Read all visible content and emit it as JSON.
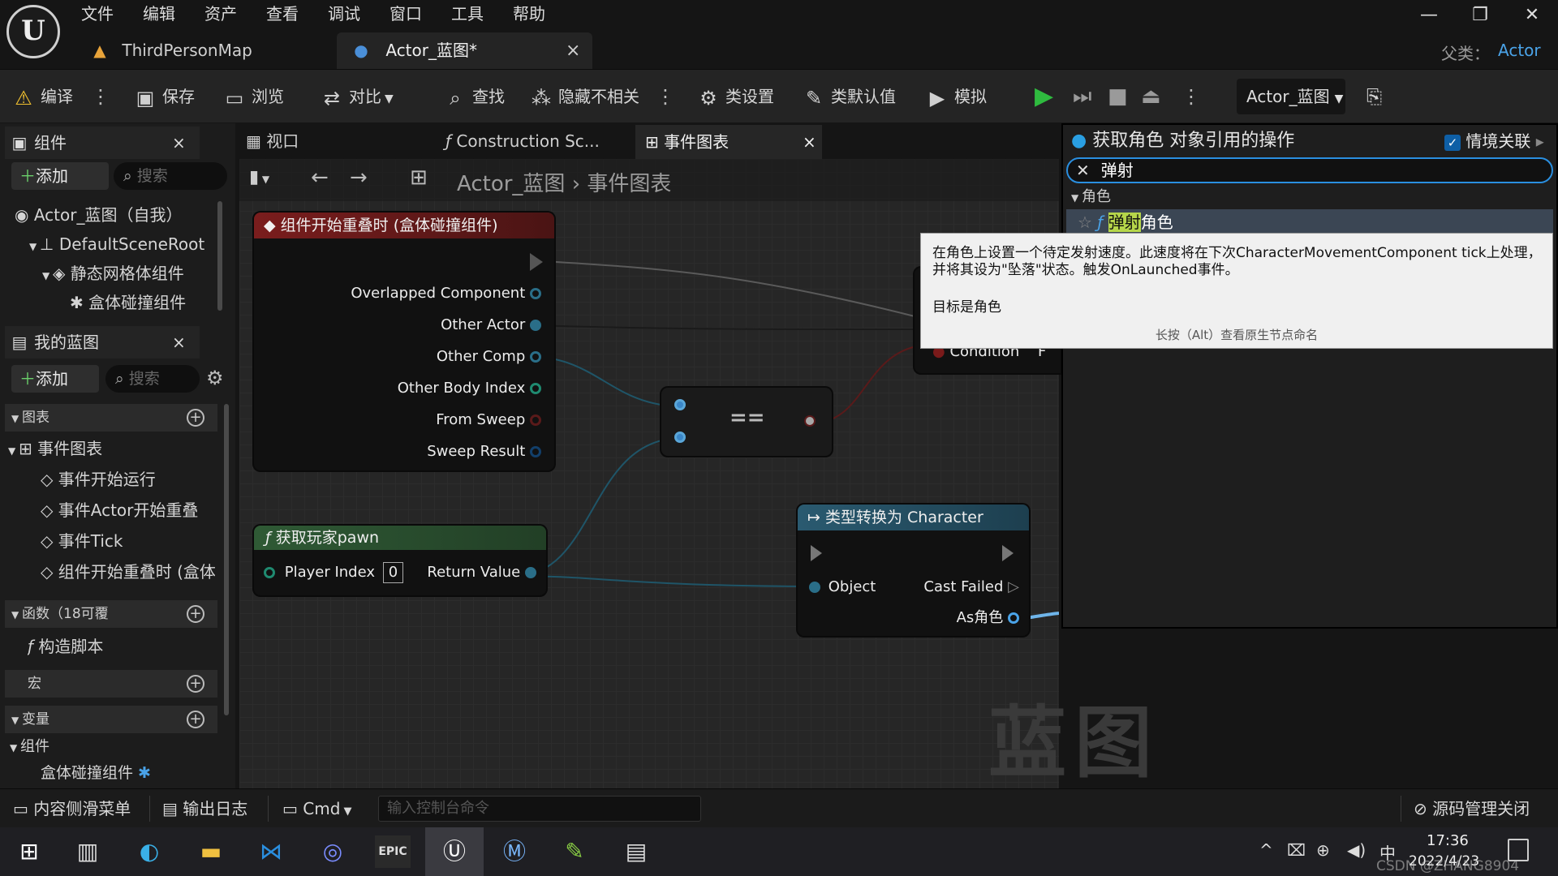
{
  "app": {
    "logo_text": "U",
    "parent_label": "父类：",
    "parent_value": "Actor"
  },
  "menu": [
    "文件",
    "编辑",
    "资产",
    "查看",
    "调试",
    "窗口",
    "工具",
    "帮助"
  ],
  "tabs": [
    {
      "label": "ThirdPersonMap"
    },
    {
      "label": "Actor_蓝图*",
      "close": "×"
    }
  ],
  "window": {
    "minimize": "—",
    "restore": "❐",
    "close": "✕"
  },
  "toolbar": {
    "compile": "编译",
    "save": "保存",
    "browse": "浏览",
    "diff": "对比",
    "find": "查找",
    "hide_unrelated": "隐藏不相关",
    "class_settings": "类设置",
    "class_defaults": "类默认值",
    "simulate": "模拟",
    "debug_object": "Actor_蓝图"
  },
  "components_panel": {
    "title": "组件",
    "add": "添加",
    "search_placeholder": "搜索",
    "items": [
      "Actor_蓝图（自我）",
      "DefaultSceneRoot",
      "静态网格体组件",
      "盒体碰撞组件"
    ]
  },
  "my_blueprint": {
    "title": "我的蓝图",
    "add": "添加",
    "search_placeholder": "搜索",
    "graphs_section": "图表",
    "event_graph": "事件图表",
    "events": [
      "事件开始运行",
      "事件Actor开始重叠",
      "事件Tick",
      "组件开始重叠时 (盒体"
    ],
    "functions_section": "函数（18可覆",
    "construction_script": "构造脚本",
    "macros_section": "宏",
    "variables_section": "变量",
    "components_category": "组件",
    "component_var": "盒体碰撞组件"
  },
  "graph_tabs": [
    {
      "label": "视口"
    },
    {
      "label": "Construction Sc..."
    },
    {
      "label": "事件图表",
      "close": "×"
    }
  ],
  "breadcrumb": {
    "root": "Actor_蓝图",
    "separator": "›",
    "current": "事件图表"
  },
  "nodes": {
    "overlap_event": {
      "title": "组件开始重叠时 (盒体碰撞组件)",
      "pins": [
        "Overlapped Component",
        "Other Actor",
        "Other Comp",
        "Other Body Index",
        "From Sweep",
        "Sweep Result"
      ]
    },
    "equal": {
      "label": "=="
    },
    "get_pawn": {
      "title": "获取玩家pawn",
      "input_label": "Player Index",
      "input_value": "0",
      "output_label": "Return Value"
    },
    "cast": {
      "title": "类型转换为 Character",
      "object_label": "Object",
      "cast_failed": "Cast Failed",
      "as_label": "As角色"
    },
    "branch": {
      "condition_label": "Condition",
      "false_label": "F"
    }
  },
  "watermark": "蓝图",
  "action_menu": {
    "title": "获取角色 对象引用的操作",
    "context_label": "情境关联",
    "search_value": "弹射",
    "category": "角色",
    "result_highlight": "弹射",
    "result_rest": "角色"
  },
  "tooltip": {
    "line1": "在角色上设置一个待定发射速度。此速度将在下次CharacterMovementComponent tick上处理，",
    "line2": "并将其设为\"坠落\"状态。触发OnLaunched事件。",
    "target": "目标是角色",
    "hint": "长按（Alt）查看原生节点命名"
  },
  "bottom": {
    "content_drawer": "内容侧滑菜单",
    "output_log": "输出日志",
    "cmd": "Cmd",
    "console_placeholder": "输入控制台命令",
    "source_control": "源码管理关闭"
  },
  "taskbar": {
    "ime": "中",
    "time": "17:36",
    "date": "2022/4/23",
    "watermark_text": "CSDN @ZHANG8904"
  },
  "colors": {
    "accent": "#2a9fe2",
    "event_header": "#7a1d1d",
    "function_header": "#2f5a35",
    "cast_header": "#2a5a70",
    "exec_green": "#2fbb3f"
  }
}
